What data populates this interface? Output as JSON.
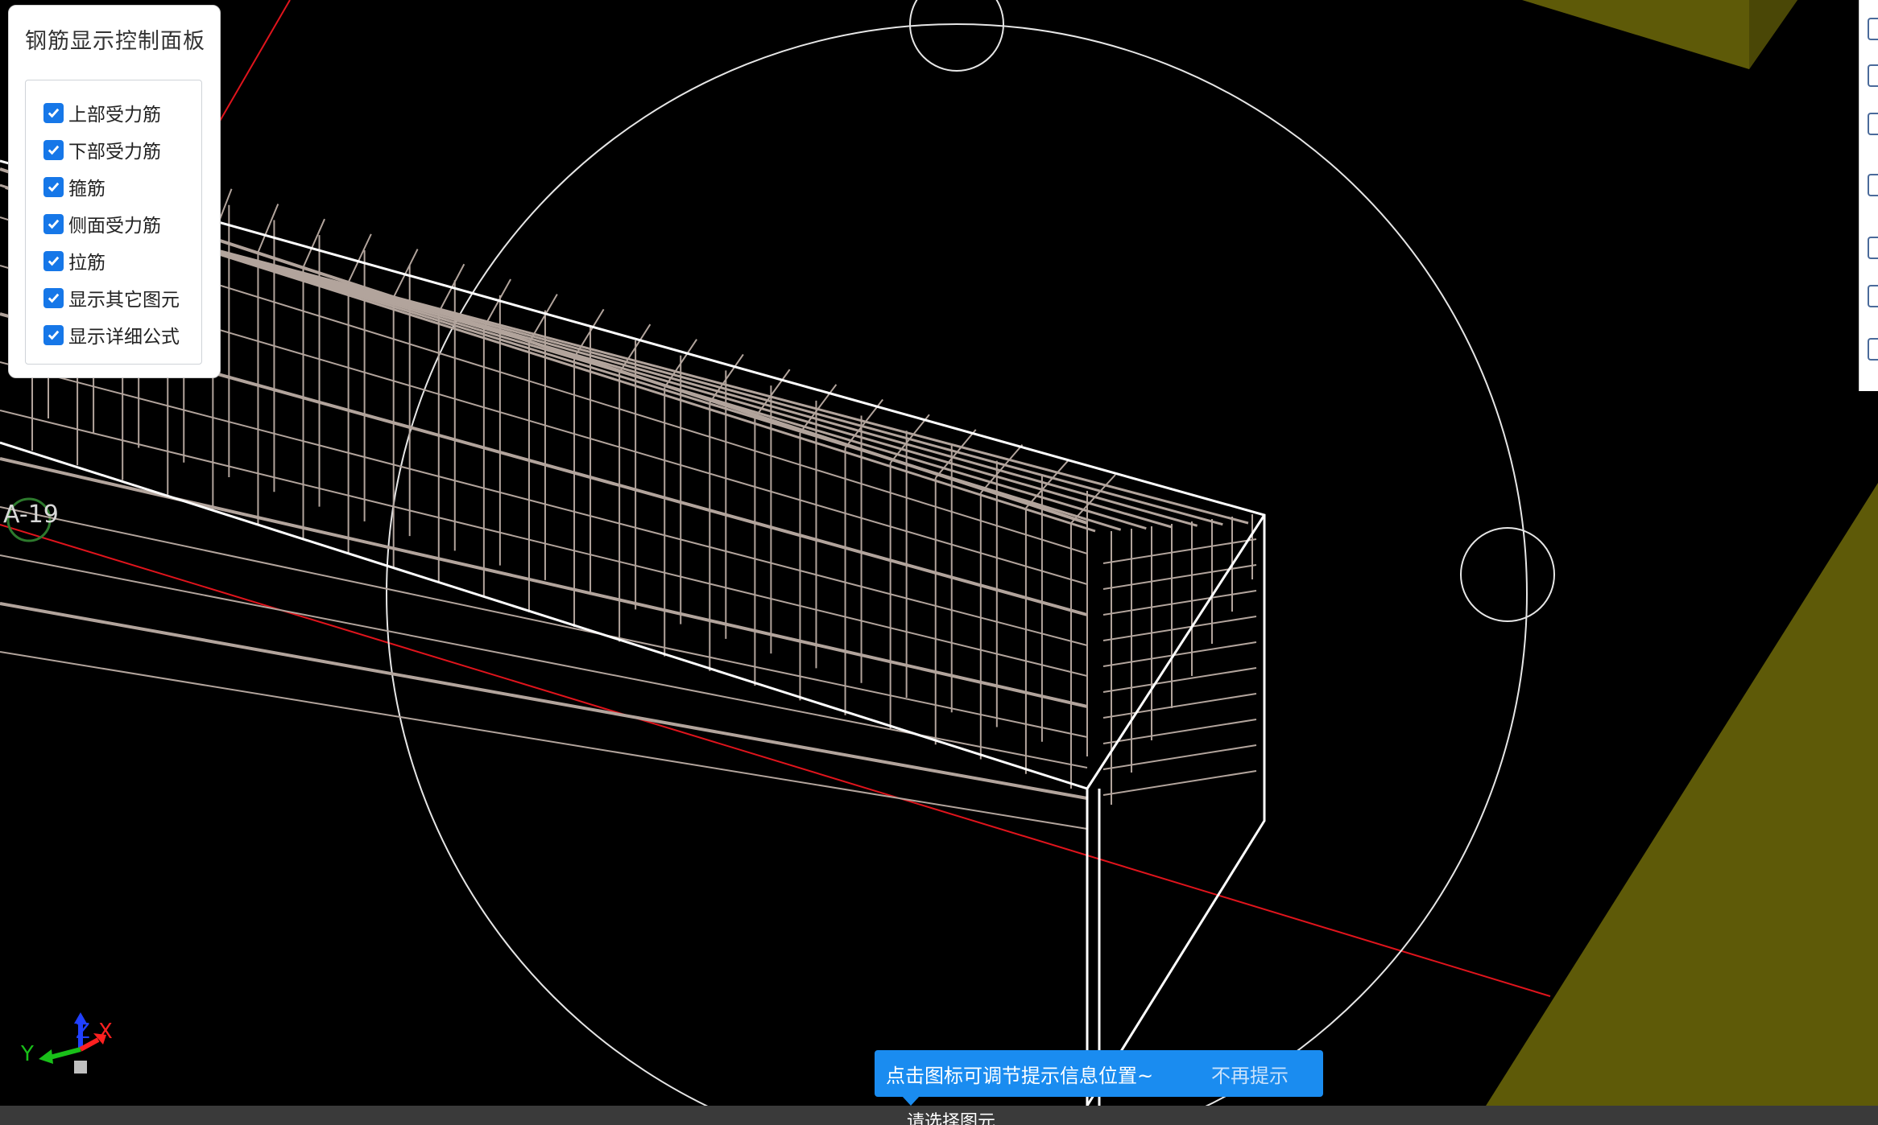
{
  "panel": {
    "title": "钢筋显示控制面板",
    "items": [
      {
        "label": "上部受力筋",
        "checked": true
      },
      {
        "label": "下部受力筋",
        "checked": true
      },
      {
        "label": "箍筋",
        "checked": true
      },
      {
        "label": "侧面受力筋",
        "checked": true
      },
      {
        "label": "拉筋",
        "checked": true
      },
      {
        "label": "显示其它图元",
        "checked": true
      },
      {
        "label": "显示详细公式",
        "checked": true
      }
    ]
  },
  "viewport": {
    "grid_label": "A-19",
    "axis": {
      "x": "X",
      "y": "Y",
      "z": "Z"
    },
    "colors": {
      "background": "#000000",
      "rebar": "#b2a49c",
      "outline": "#ffffff",
      "axis_line": "#e0141c",
      "slab": "#5e5a08",
      "circle": "#e6e6e6"
    }
  },
  "hint": {
    "text": "点击图标可调节提示信息位置~",
    "dismiss": "不再提示"
  },
  "status": {
    "text": "请选择图元"
  }
}
